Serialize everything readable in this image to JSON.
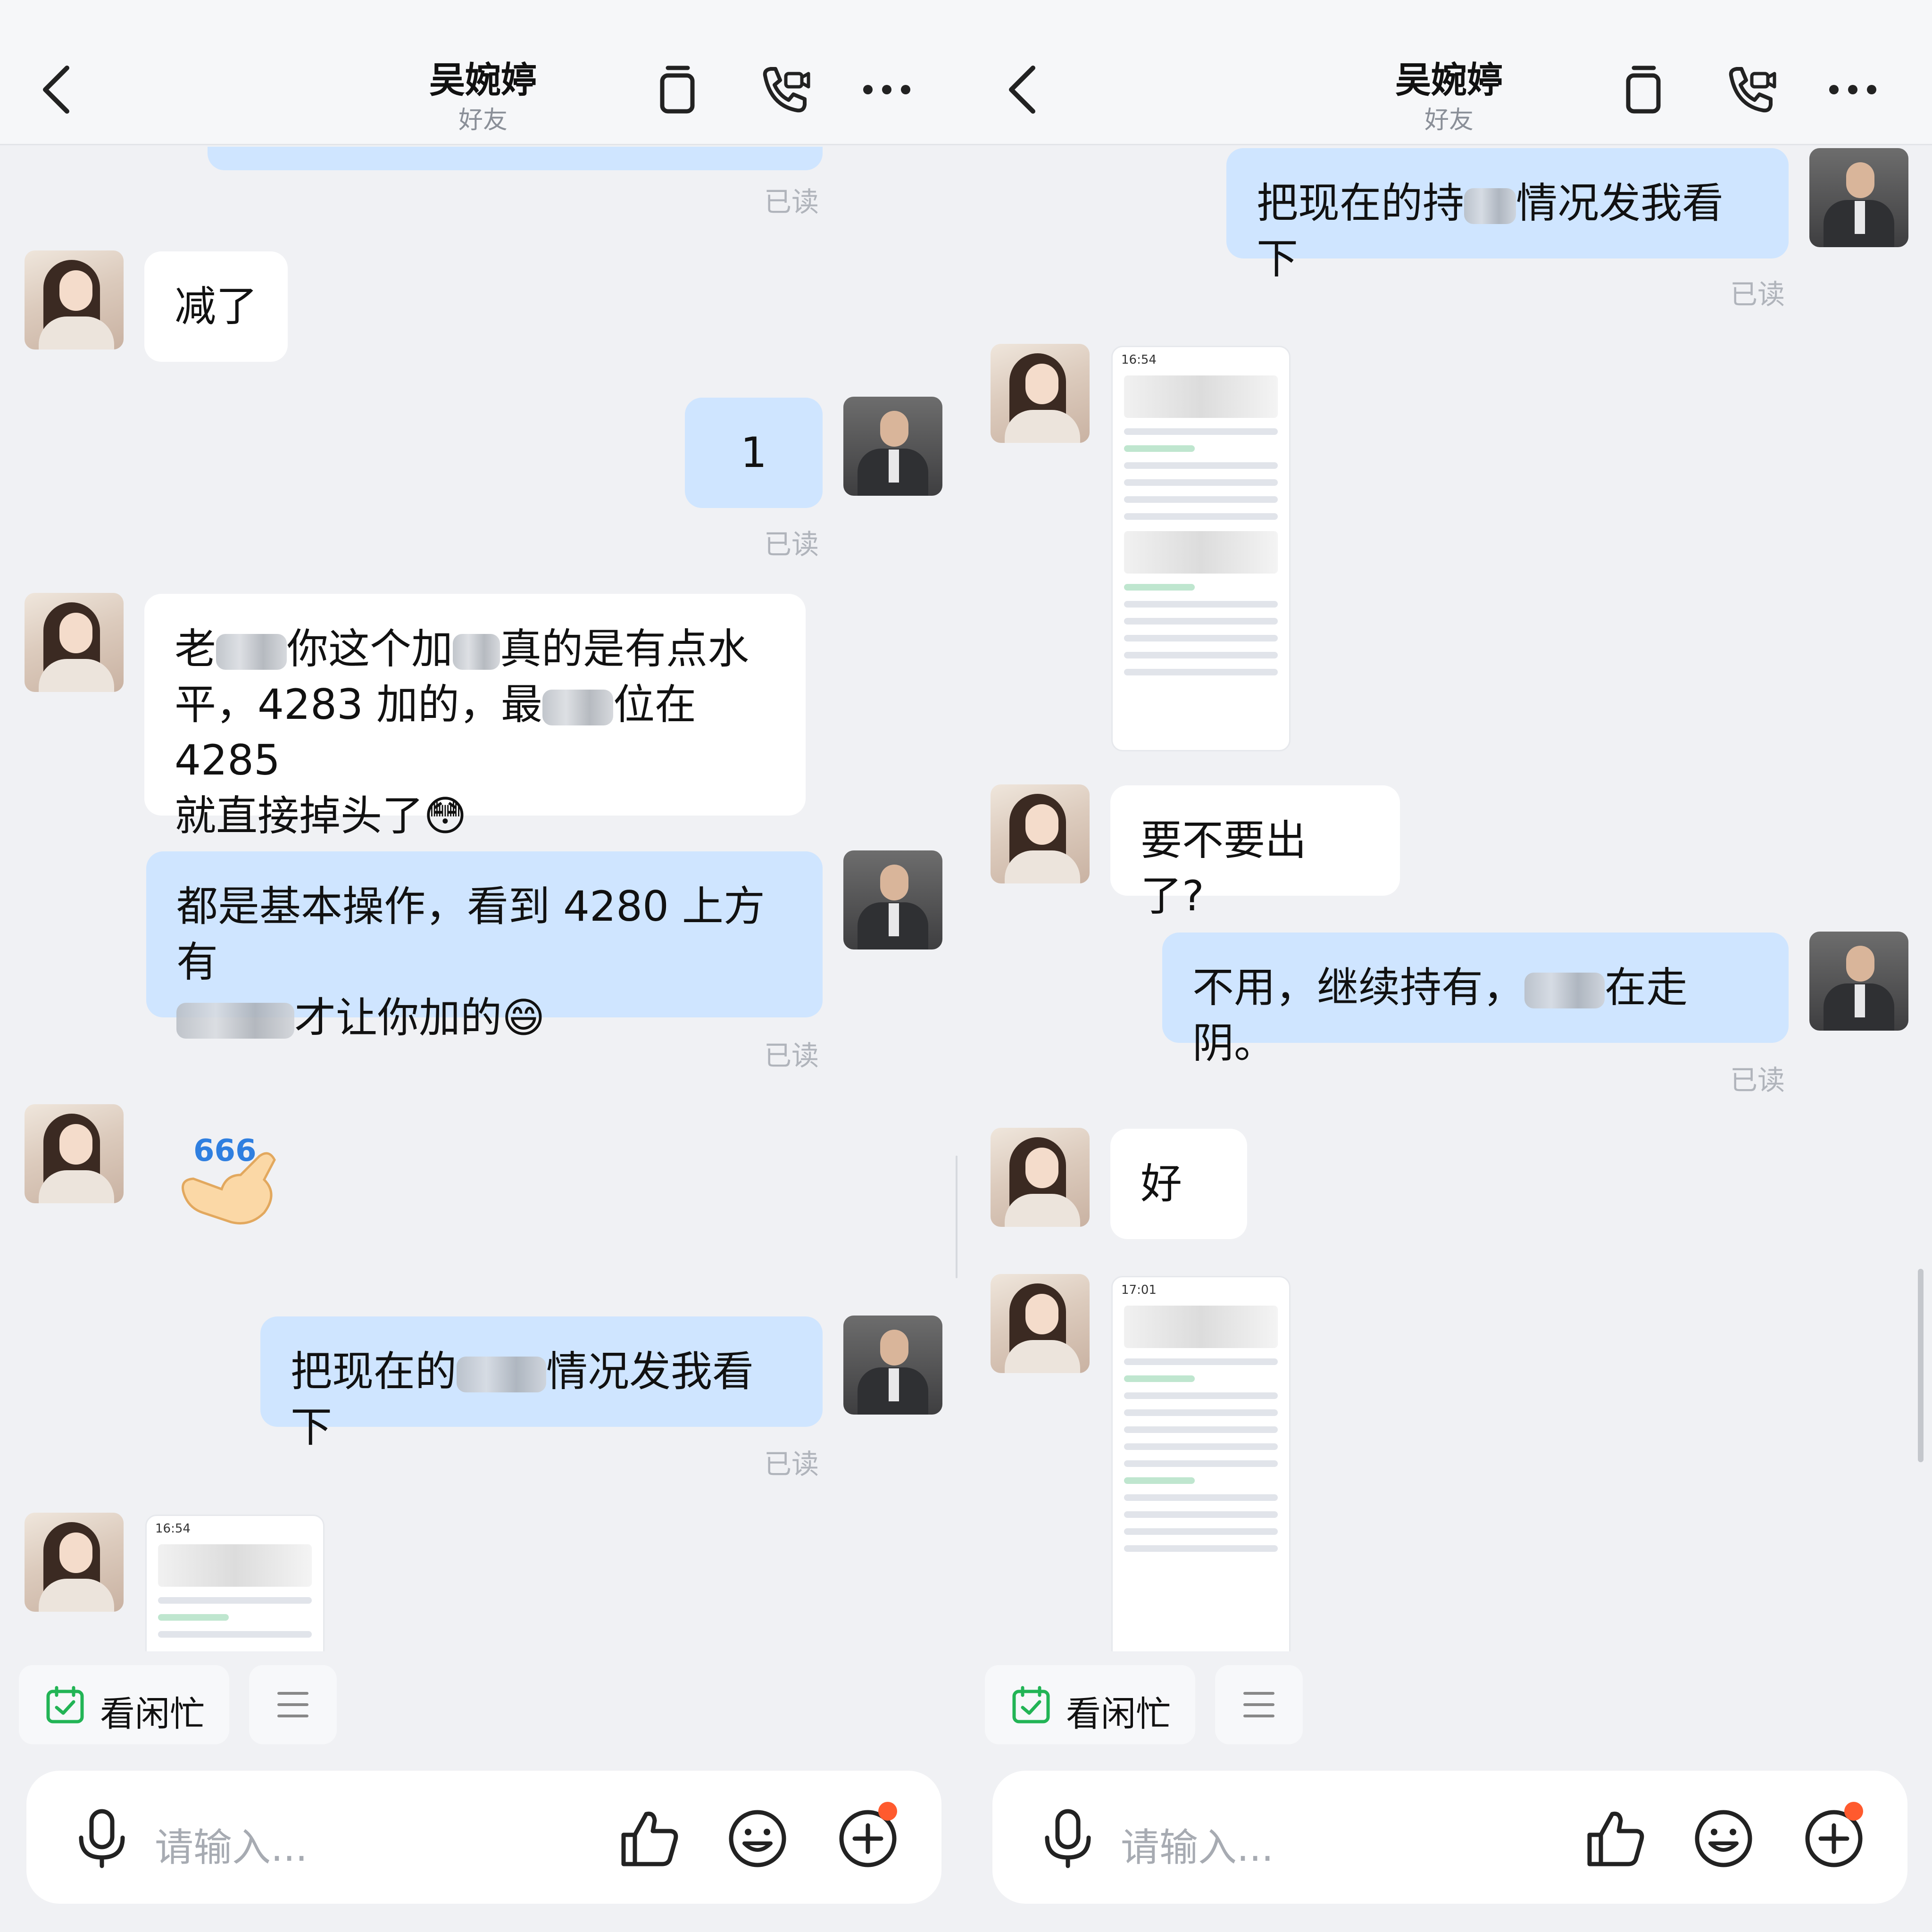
{
  "header": {
    "contact_name": "吴婉婷",
    "contact_status": "好友"
  },
  "left": {
    "read_1": "已读",
    "msg_1": "减了",
    "msg_2": "1",
    "read_2": "已读",
    "msg_3_a": "老",
    "msg_3_b": "你这个加",
    "msg_3_c": "真的是有点水",
    "msg_3_d": "平，4283 加的，最",
    "msg_3_e": "位在 4285",
    "msg_3_f": "就直接掉头了😳",
    "msg_4_a": "都是基本操作，看到 4280 上方有",
    "msg_4_b": "才让你加的😄",
    "read_3": "已读",
    "sticker_text": "666",
    "msg_5_a": "把现在的",
    "msg_5_b": "情况发我看下",
    "read_4": "已读",
    "shot_time": "16:54"
  },
  "right": {
    "msg_1_a": "把现在的持",
    "msg_1_b": "情况发我看下",
    "read_1": "已读",
    "shot_1_time": "16:54",
    "msg_2": "要不要出了?",
    "msg_3_a": "不用，继续持有，",
    "msg_3_b": "在走阴。",
    "read_2": "已读",
    "msg_4": "好",
    "shot_2_time": "17:01"
  },
  "quick_actions": {
    "busy_label": "看闲忙"
  },
  "input": {
    "placeholder": "请输入..."
  },
  "colors": {
    "outgoing_bubble": "#cfe5ff",
    "incoming_bubble": "#ffffff",
    "accent_green": "#22b455",
    "notification_dot": "#ff5a2e"
  },
  "icons": [
    "back-icon",
    "copy-icon",
    "video-call-icon",
    "more-icon",
    "calendar-check-icon",
    "menu-icon",
    "mic-icon",
    "thumbs-up-icon",
    "emoji-icon",
    "plus-icon"
  ]
}
